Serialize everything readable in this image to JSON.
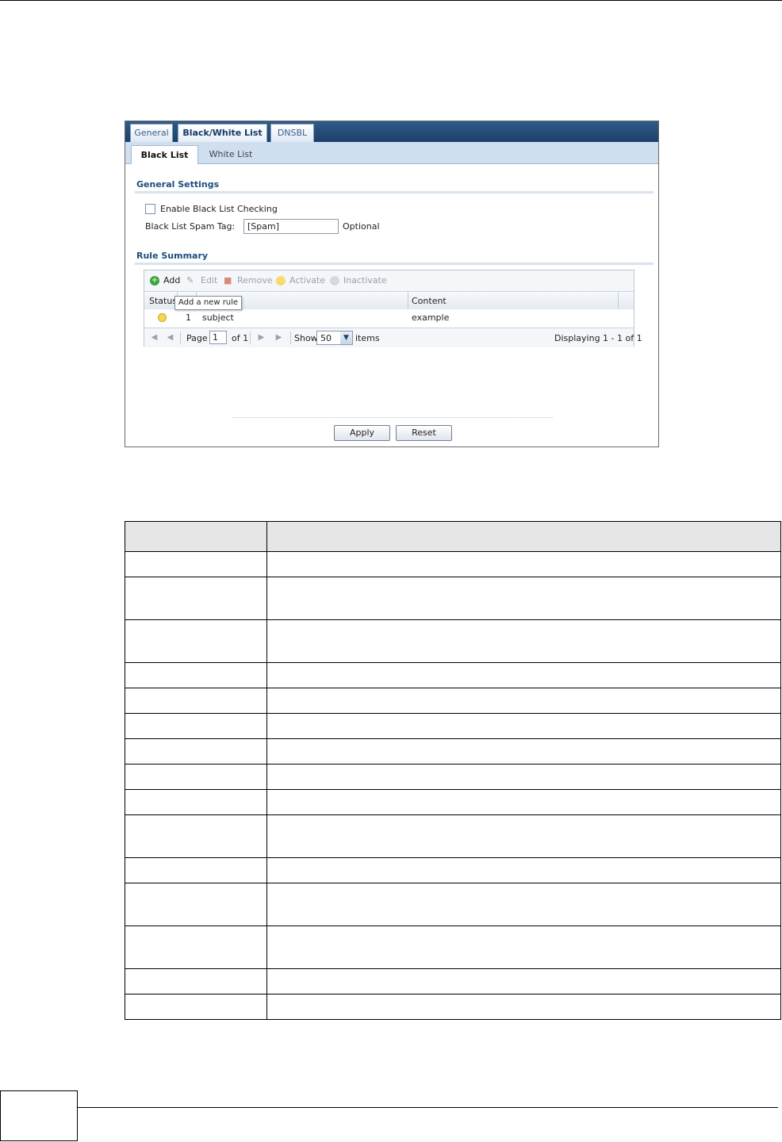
{
  "tabs": [
    "General",
    "Black/White List",
    "DNSBL"
  ],
  "active_tab": "Black/White List",
  "subtabs": [
    "Black List",
    "White List"
  ],
  "active_subtab": "Black List",
  "general_settings": {
    "title": "General Settings",
    "enable_checkbox_label": "Enable Black List Checking",
    "enable_checked": false,
    "spam_tag_label": "Black List Spam Tag:",
    "spam_tag_value": "[Spam]",
    "spam_tag_hint": "Optional"
  },
  "rule_summary": {
    "title": "Rule Summary",
    "toolbar": {
      "add": "Add",
      "edit": "Edit",
      "remove": "Remove",
      "activate": "Activate",
      "inactivate": "Inactivate"
    },
    "tooltip": "Add a new rule",
    "columns": {
      "status": "Status",
      "content": "Content"
    },
    "rows": [
      {
        "status_icon": "lightbulb-on-icon",
        "number": "1",
        "type": "subject",
        "content": "example"
      }
    ],
    "pager": {
      "page_label": "Page",
      "page_value": "1",
      "of_label": "of 1",
      "show_label": "Show",
      "show_value": "50",
      "items_label": "items",
      "displaying": "Displaying 1 - 1 of 1"
    }
  },
  "buttons": {
    "apply": "Apply",
    "reset": "Reset"
  },
  "colors": {
    "tabbar": "#1d3f68",
    "section_title": "#1d4d7e",
    "subtab_bg": "#cfdff0"
  }
}
